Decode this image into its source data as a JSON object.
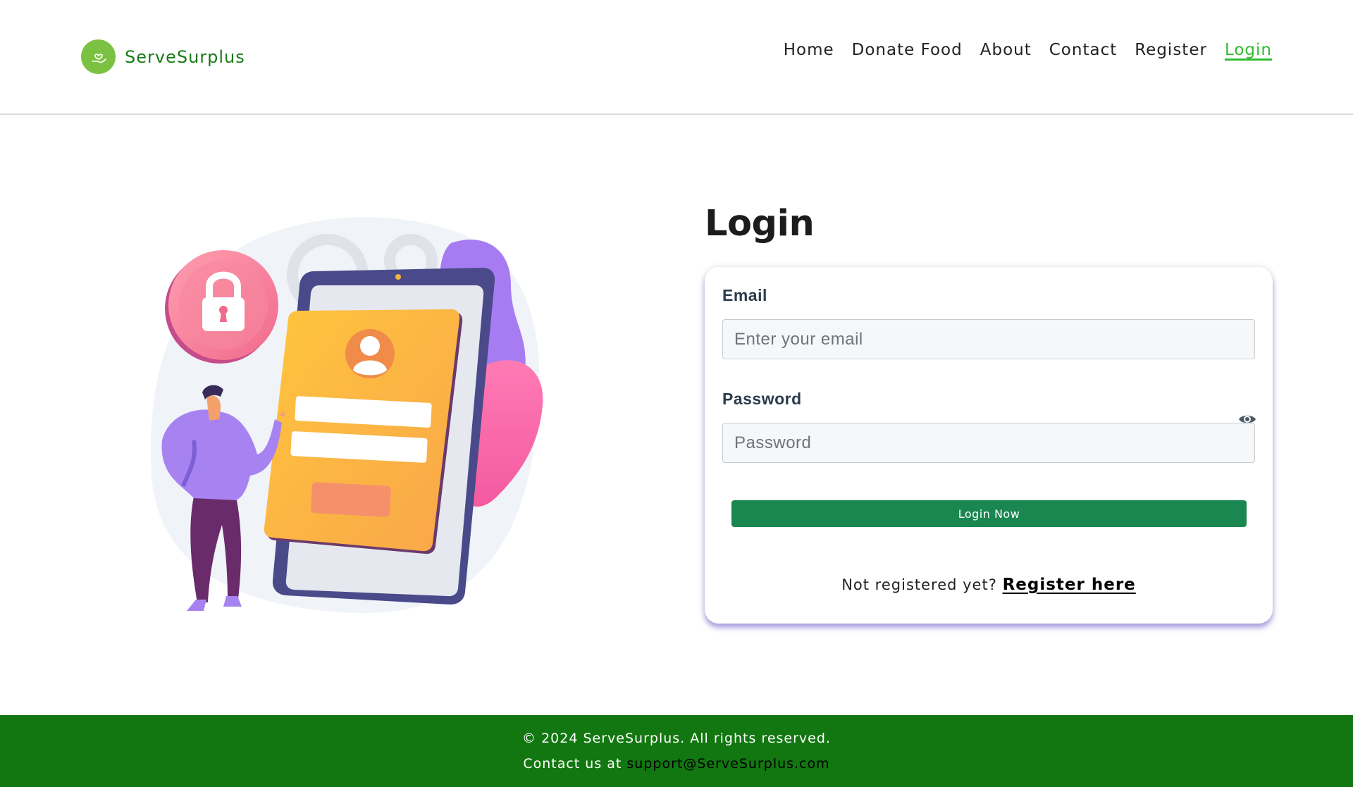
{
  "brand": {
    "name": "ServeSurplus",
    "icon": "hand-heart-icon",
    "color": "#187a17"
  },
  "nav": {
    "items": [
      {
        "label": "Home"
      },
      {
        "label": "Donate Food"
      },
      {
        "label": "About"
      },
      {
        "label": "Contact"
      },
      {
        "label": "Register"
      },
      {
        "label": "Login",
        "active": true
      }
    ],
    "active_color": "#2ebd2e"
  },
  "login": {
    "title": "Login",
    "email_label": "Email",
    "email_placeholder": "Enter your email",
    "email_value": "",
    "password_label": "Password",
    "password_placeholder": "Password",
    "password_value": "",
    "password_toggle_icon": "eye-icon",
    "submit_label": "Login Now",
    "register_prompt": "Not registered yet?",
    "register_link": "Register here",
    "button_color": "#1b8750"
  },
  "footer": {
    "copyright": "© 2024 ServeSurplus. All rights reserved.",
    "contact_prefix": "Contact us at",
    "contact_email": "support@ServeSurplus.com",
    "background": "#127710"
  }
}
